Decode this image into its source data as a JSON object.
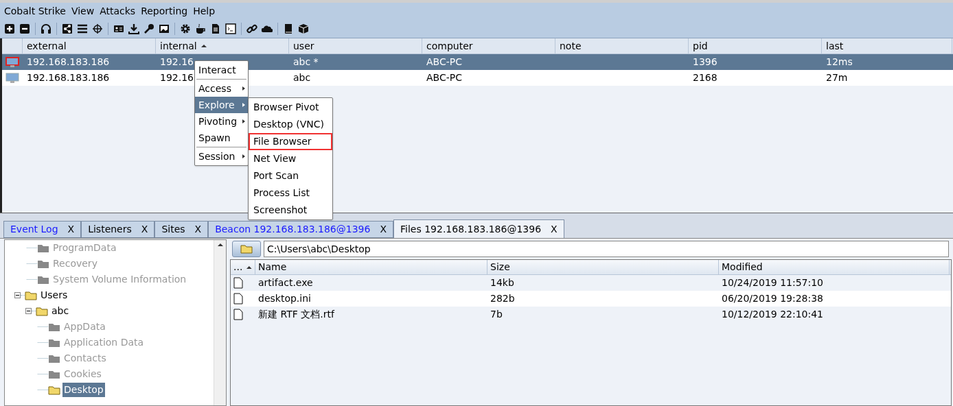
{
  "menu_bar": [
    "Cobalt Strike",
    "View",
    "Attacks",
    "Reporting",
    "Help"
  ],
  "sessions_table": {
    "columns": [
      {
        "label": "external",
        "sorted": false
      },
      {
        "label": "internal",
        "sorted": true
      },
      {
        "label": "user",
        "sorted": false
      },
      {
        "label": "computer",
        "sorted": false
      },
      {
        "label": "note",
        "sorted": false
      },
      {
        "label": "pid",
        "sorted": false
      },
      {
        "label": "last",
        "sorted": false
      }
    ],
    "rows": [
      {
        "selected": true,
        "elevated": true,
        "cells": [
          "192.168.183.186",
          "192.16",
          "abc *",
          "ABC-PC",
          "",
          "1396",
          "12ms"
        ]
      },
      {
        "selected": false,
        "elevated": false,
        "cells": [
          "192.168.183.186",
          "192.16",
          "abc",
          "ABC-PC",
          "",
          "2168",
          "27m"
        ]
      }
    ]
  },
  "context_menu": [
    {
      "kind": "item",
      "label": "Interact",
      "submenu": false,
      "highlighted": false
    },
    {
      "kind": "separator"
    },
    {
      "kind": "item",
      "label": "Access",
      "submenu": true,
      "highlighted": false
    },
    {
      "kind": "item",
      "label": "Explore",
      "submenu": true,
      "highlighted": true
    },
    {
      "kind": "item",
      "label": "Pivoting",
      "submenu": true,
      "highlighted": false
    },
    {
      "kind": "item",
      "label": "Spawn",
      "submenu": false,
      "highlighted": false
    },
    {
      "kind": "separator"
    },
    {
      "kind": "item",
      "label": "Session",
      "submenu": true,
      "highlighted": false
    }
  ],
  "submenu": [
    {
      "label": "Browser Pivot",
      "outlined": false
    },
    {
      "label": "Desktop (VNC)",
      "outlined": false
    },
    {
      "label": "File Browser",
      "outlined": true
    },
    {
      "label": "Net View",
      "outlined": false
    },
    {
      "label": "Port Scan",
      "outlined": false
    },
    {
      "label": "Process List",
      "outlined": false
    },
    {
      "label": "Screenshot",
      "outlined": false
    }
  ],
  "tabs": [
    {
      "label": "Event Log",
      "close": "X",
      "selected": false,
      "highlighted": true
    },
    {
      "label": "Listeners",
      "close": "X",
      "selected": false,
      "highlighted": false
    },
    {
      "label": "Sites",
      "close": "X",
      "selected": false,
      "highlighted": false
    },
    {
      "label": "Beacon 192.168.183.186@1396",
      "close": "X",
      "selected": false,
      "highlighted": true
    },
    {
      "label": "Files 192.168.183.186@1396",
      "close": "X",
      "selected": true,
      "highlighted": false
    }
  ],
  "folder_tree": [
    {
      "label": "ProgramData",
      "loaded": false,
      "selected": false
    },
    {
      "label": "Recovery",
      "loaded": false,
      "selected": false
    },
    {
      "label": "System Volume Information",
      "loaded": false,
      "selected": false
    },
    {
      "label": "Users",
      "loaded": true,
      "selected": false,
      "expanded": true,
      "children": [
        {
          "label": "abc",
          "loaded": true,
          "selected": false,
          "expanded": true,
          "children": [
            {
              "label": "AppData",
              "loaded": false,
              "selected": false
            },
            {
              "label": "Application Data",
              "loaded": false,
              "selected": false
            },
            {
              "label": "Contacts",
              "loaded": false,
              "selected": false
            },
            {
              "label": "Cookies",
              "loaded": false,
              "selected": false
            },
            {
              "label": "Desktop",
              "loaded": true,
              "selected": true
            }
          ]
        }
      ]
    }
  ],
  "path_field": {
    "value": "C:\\Users\\abc\\Desktop"
  },
  "files_table": {
    "columns": [
      "...",
      "Name",
      "Size",
      "Modified"
    ],
    "rows": [
      {
        "name": "artifact.exe",
        "size": "14kb",
        "modified": "10/24/2019 11:57:10"
      },
      {
        "name": "desktop.ini",
        "size": "282b",
        "modified": "06/20/2019 19:28:38"
      },
      {
        "name": "新建 RTF 文档.rtf",
        "size": "7b",
        "modified": "10/12/2019 22:10:41"
      }
    ]
  }
}
